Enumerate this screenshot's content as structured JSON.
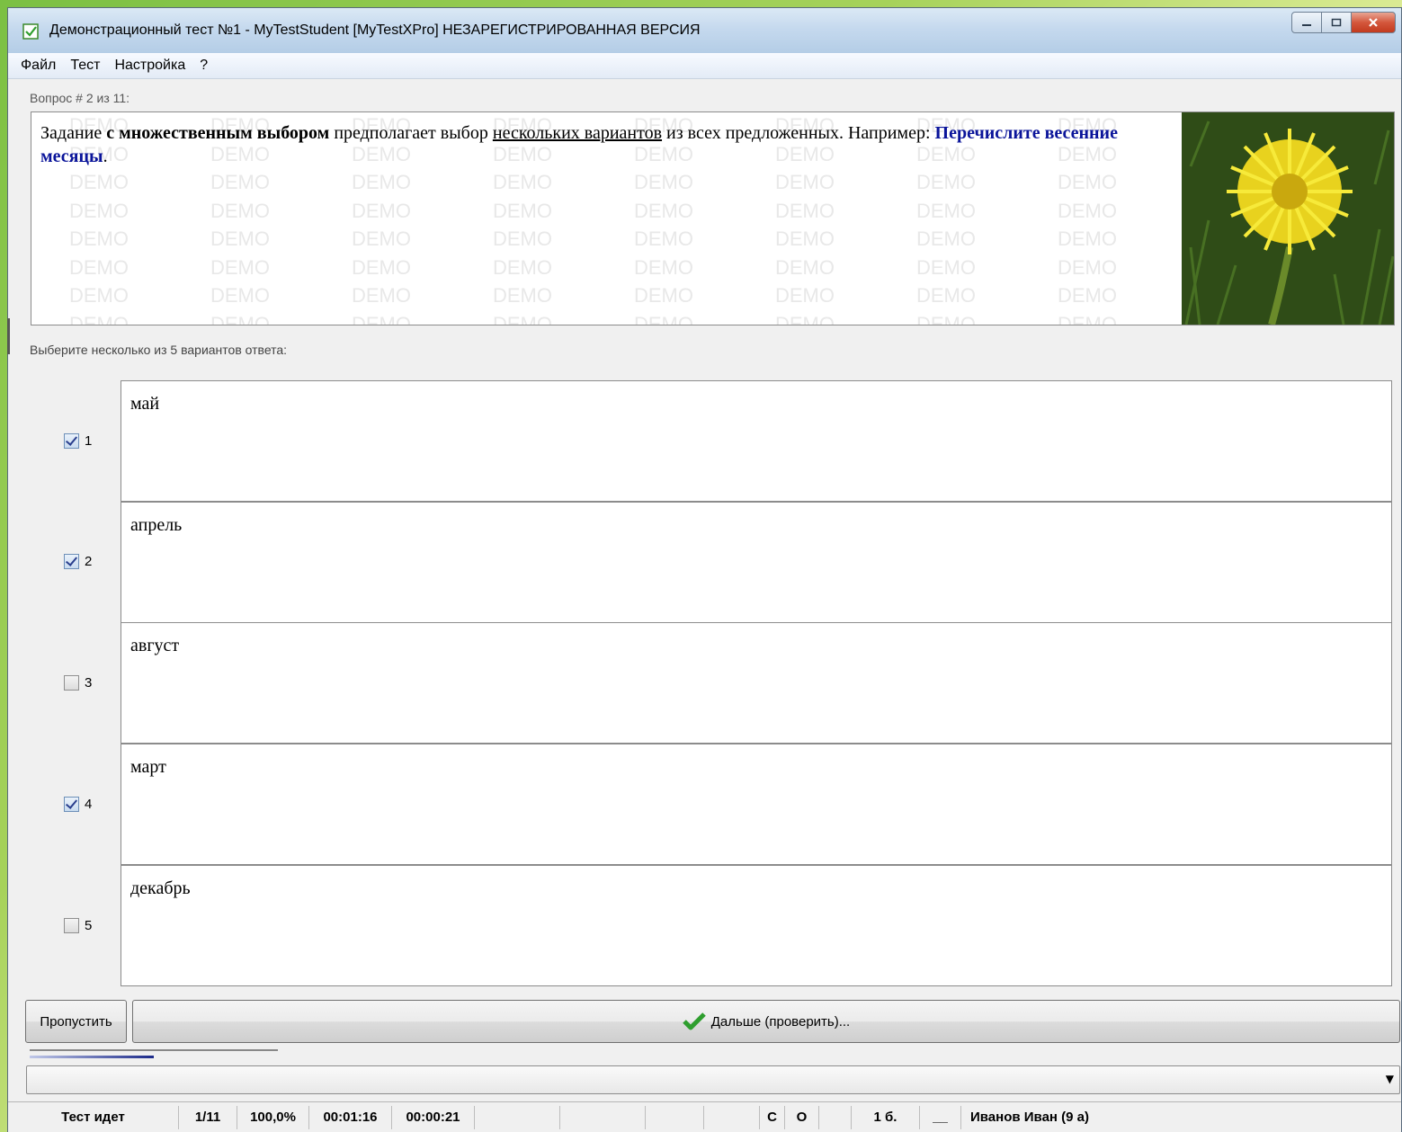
{
  "window": {
    "title": "Демонстрационный тест №1 - MyTestStudent [MyTestXPro] НЕЗАРЕГИСТРИРОВАННАЯ ВЕРСИЯ"
  },
  "menu": [
    "Файл",
    "Тест",
    "Настройка",
    "?"
  ],
  "question": {
    "counter": "Вопрос # 2 из 11:",
    "parts": {
      "p1": "Задание ",
      "p2": "с множественным выбором",
      "p3": " предполагает выбор ",
      "p4": "нескольких вариантов",
      "p5": " из всех предложенных. Например: ",
      "p6": "Перечислите весенние месяцы",
      "p7": "."
    },
    "watermark_text": "DEMO",
    "image": "dandelion-photo"
  },
  "answers_prompt": "Выберите несколько из 5 вариантов ответа:",
  "answers": [
    {
      "num": "1",
      "text": "май",
      "checked": true
    },
    {
      "num": "2",
      "text": "апрель",
      "checked": true
    },
    {
      "num": "3",
      "text": "август",
      "checked": false
    },
    {
      "num": "4",
      "text": "март",
      "checked": true
    },
    {
      "num": "5",
      "text": "декабрь",
      "checked": false
    }
  ],
  "buttons": {
    "skip": "Пропустить",
    "next": "Дальше (проверить)..."
  },
  "progress": {
    "fraction": 0.5
  },
  "status": {
    "state": "Тест идет",
    "position": "1/11",
    "percent": "100,0%",
    "time_total": "00:01:16",
    "time_question": "00:00:21",
    "c": "С",
    "o": "О",
    "score": "1 б.",
    "blank": "__",
    "user": "Иванов Иван (9 а)"
  },
  "colors": {
    "accent_blue": "#0a149a",
    "check_green": "#2e9e2e",
    "close_red": "#c23a1e"
  }
}
